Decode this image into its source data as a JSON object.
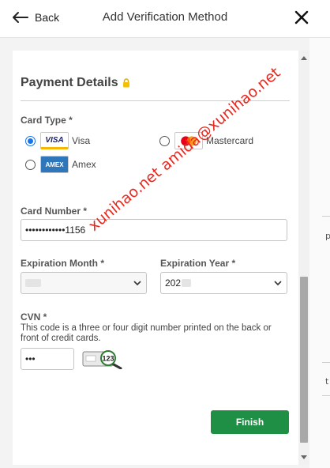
{
  "header": {
    "back_label": "Back",
    "title": "Add Verification Method"
  },
  "payment": {
    "section_title": "Payment Details",
    "card_type_label": "Card Type *",
    "card_types": [
      {
        "label": "Visa",
        "logo_text": "VISA",
        "selected": true
      },
      {
        "label": "Mastercard",
        "logo_text": "",
        "selected": false
      },
      {
        "label": "Amex",
        "logo_text": "AMEX",
        "selected": false
      }
    ],
    "card_number_label": "Card Number *",
    "card_number_value": "••••••••••••1156",
    "exp_month_label": "Expiration Month *",
    "exp_year_label": "Expiration Year *",
    "exp_year_value": "202",
    "cvn_label": "CVN *",
    "cvn_help": "This code is a three or four digit number printed on the back or front of credit cards.",
    "cvn_value": "•••",
    "cvn_image_text": "123",
    "finish_label": "Finish"
  },
  "watermark": "xunihao.net amida@xunihao.net",
  "edge": {
    "mark1": "p",
    "mark2": "t"
  },
  "colors": {
    "finish_button": "#1e8f44",
    "radio_selected": "#1a73e8",
    "watermark": "#e8281e"
  }
}
